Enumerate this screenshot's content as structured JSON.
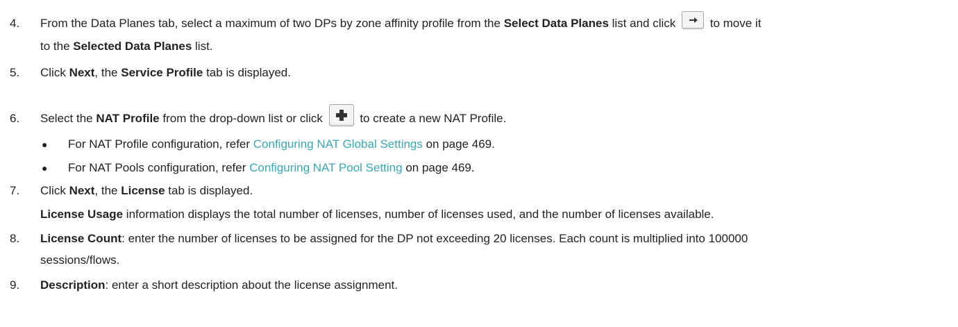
{
  "steps": {
    "s4": {
      "num": "4.",
      "t1": "From the Data Planes tab, select a maximum of two DPs by zone affinity profile from the ",
      "b1": "Select Data Planes",
      "t2": " list and click ",
      "t3": " to move it",
      "t4": "to the ",
      "b2": "Selected Data Planes",
      "t5": " list.",
      "icon": "right-arrow-icon"
    },
    "s5": {
      "num": "5.",
      "t1": "Click ",
      "b1": "Next",
      "t2": ", the ",
      "b2": "Service Profile",
      "t3": " tab is displayed."
    },
    "s6": {
      "num": "6.",
      "t1": "Select the ",
      "b1": "NAT Profile",
      "t2": " from the drop-down list or click ",
      "t3": " to create a new NAT Profile.",
      "icon": "plus-icon"
    },
    "bullet1": {
      "mark": "●",
      "t1": "For NAT Profile configuration, refer ",
      "link": "Configuring NAT Global Settings",
      "t2": " on page 469."
    },
    "bullet2": {
      "mark": "●",
      "t1": "For NAT Pools configuration, refer ",
      "link": "Configuring NAT Pool Setting",
      "t2": " on page 469."
    },
    "s7": {
      "num": "7.",
      "t1": "Click ",
      "b1": "Next",
      "t2": ", the ",
      "b2": "License",
      "t3": " tab is displayed.",
      "sub_b": "License Usage",
      "sub_t": " information displays the total number of licenses, number of licenses used, and the number of licenses available."
    },
    "s8": {
      "num": "8.",
      "b1": "License Count",
      "t1": ": enter the number of licenses to be assigned for the DP not exceeding 20 licenses. Each count is multiplied into 100000",
      "t2": "sessions/flows."
    },
    "s9": {
      "num": "9.",
      "b1": "Description",
      "t1": ": enter a short description about the license assignment."
    }
  },
  "colors": {
    "link": "#3aa8b4",
    "text": "#222222",
    "icon": "#333333"
  }
}
